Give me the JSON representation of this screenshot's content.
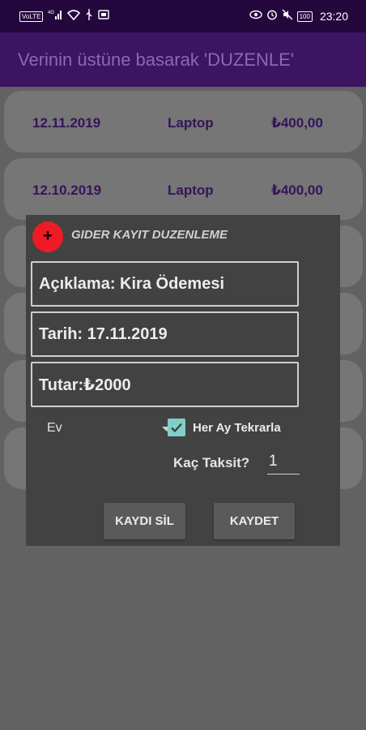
{
  "status_bar": {
    "left_icons": [
      "volte-icon",
      "signal-icon",
      "wifi-icon",
      "usb-icon",
      "sim-card-icon"
    ],
    "right_icons": [
      "eye-icon",
      "alarm-icon",
      "mute-icon"
    ],
    "volte": "VoLTE",
    "signal": "4G",
    "battery": "100",
    "time": "23:20"
  },
  "app_bar": {
    "title": "Verinin üstüne basarak 'DUZENLE'",
    "background": "#3c1462",
    "title_color": "#8e66b2"
  },
  "list": {
    "rows": [
      {
        "date": "12.11.2019",
        "description": "Laptop",
        "amount": "₺400,00"
      },
      {
        "date": "12.10.2019",
        "description": "Laptop",
        "amount": "₺400,00"
      }
    ],
    "text_color": "#35145a"
  },
  "dialog": {
    "icon_label": "+",
    "icon_color": "#ee1b27",
    "title": "GIDER KAYIT DUZENLEME",
    "fields": {
      "description": "Açıklama: Kira Ödemesi",
      "date": "Tarih: 17.11.2019",
      "amount": "Tutar:₺2000"
    },
    "category": {
      "selected": "Ev"
    },
    "repeat_monthly": {
      "label": "Her Ay Tekrarla",
      "checked": true,
      "color": "#7fcfc9"
    },
    "installments": {
      "label": "Kaç Taksit?",
      "value": "1"
    },
    "buttons": {
      "delete": "KAYDI SİL",
      "save": "KAYDET"
    }
  }
}
